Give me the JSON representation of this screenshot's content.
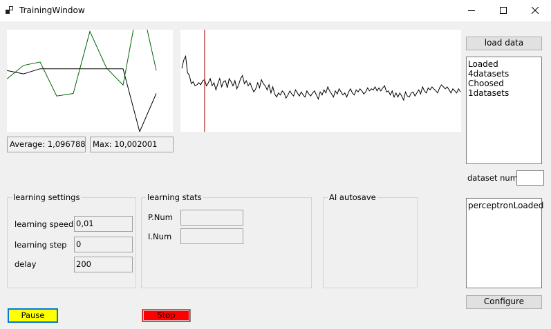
{
  "window": {
    "title": "TrainingWindow",
    "controls": [
      "minimize-icon",
      "maximize-icon",
      "close-icon"
    ]
  },
  "stats": {
    "average": "Average: 1,096788",
    "max": "Max: 10,002001"
  },
  "buttons": {
    "load_data": "load data",
    "configure": "Configure",
    "pause": "Pause",
    "stop": "Stop"
  },
  "log_list": [
    "Loaded 4datasets",
    "Choosed 1datasets"
  ],
  "dataset_num": {
    "label": "dataset num",
    "value": ""
  },
  "model_list": [
    "perceptronLoaded"
  ],
  "learning_settings": {
    "title": "learning settings",
    "speed_label": "learning speed",
    "speed_value": "0,01",
    "step_label": "learning step",
    "step_value": "0",
    "delay_label": "delay",
    "delay_value": "200"
  },
  "learning_stats": {
    "title": "learning stats",
    "pnum_label": "P.Num",
    "pnum_value": "",
    "inum_label": "I.Num",
    "inum_value": ""
  },
  "autosave": {
    "title": "AI autosave"
  },
  "colors": {
    "pause": "#ffff00",
    "pause_border": "#0078d7",
    "stop": "#ff0000",
    "series_green": "#006400",
    "series_black": "#000000",
    "cursor_red": "#a00000"
  },
  "chart_data": [
    {
      "type": "line",
      "series": [
        {
          "values": [
            0.62,
            0.78,
            0.82,
            0.42,
            0.45,
            1.18,
            0.75,
            0.55,
            1.6,
            0.72
          ]
        },
        {
          "values": [
            0.72,
            0.68,
            0.74,
            0.74,
            0.74,
            0.74,
            0.74,
            0.74,
            0.0,
            0.45
          ]
        }
      ],
      "ylim": [
        0,
        1.2
      ],
      "grid": false
    },
    {
      "type": "line",
      "series": [
        {
          "values": [
            0.62,
            0.7,
            0.74,
            0.58,
            0.55,
            0.47,
            0.49,
            0.45,
            0.46,
            0.48,
            0.46,
            0.5,
            0.51,
            0.45,
            0.48,
            0.52,
            0.45,
            0.48,
            0.41,
            0.47,
            0.52,
            0.44,
            0.49,
            0.5,
            0.43,
            0.52,
            0.49,
            0.45,
            0.5,
            0.42,
            0.46,
            0.52,
            0.55,
            0.47,
            0.5,
            0.45,
            0.48,
            0.43,
            0.39,
            0.42,
            0.48,
            0.43,
            0.51,
            0.47,
            0.45,
            0.41,
            0.46,
            0.38,
            0.44,
            0.37,
            0.34,
            0.38,
            0.36,
            0.4,
            0.38,
            0.33,
            0.36,
            0.4,
            0.37,
            0.35,
            0.41,
            0.38,
            0.35,
            0.39,
            0.36,
            0.34,
            0.4,
            0.37,
            0.35,
            0.38,
            0.4,
            0.36,
            0.32,
            0.39,
            0.36,
            0.41,
            0.38,
            0.44,
            0.4,
            0.37,
            0.34,
            0.4,
            0.37,
            0.42,
            0.39,
            0.36,
            0.38,
            0.34,
            0.39,
            0.42,
            0.38,
            0.36,
            0.41,
            0.39,
            0.42,
            0.4,
            0.37,
            0.39,
            0.43,
            0.4,
            0.42,
            0.41,
            0.44,
            0.4,
            0.43,
            0.4,
            0.43,
            0.45,
            0.39,
            0.4,
            0.36,
            0.4,
            0.34,
            0.38,
            0.34,
            0.38,
            0.35,
            0.31,
            0.39,
            0.35,
            0.34,
            0.38,
            0.39,
            0.35,
            0.38,
            0.41,
            0.37,
            0.44,
            0.4,
            0.38,
            0.43,
            0.41,
            0.44,
            0.42,
            0.4,
            0.38,
            0.43,
            0.46,
            0.44,
            0.42,
            0.44,
            0.41,
            0.38,
            0.42,
            0.4,
            0.38,
            0.42,
            0.39
          ]
        }
      ],
      "marker_index": 12,
      "ylim": [
        0,
        1
      ],
      "grid": false
    }
  ]
}
